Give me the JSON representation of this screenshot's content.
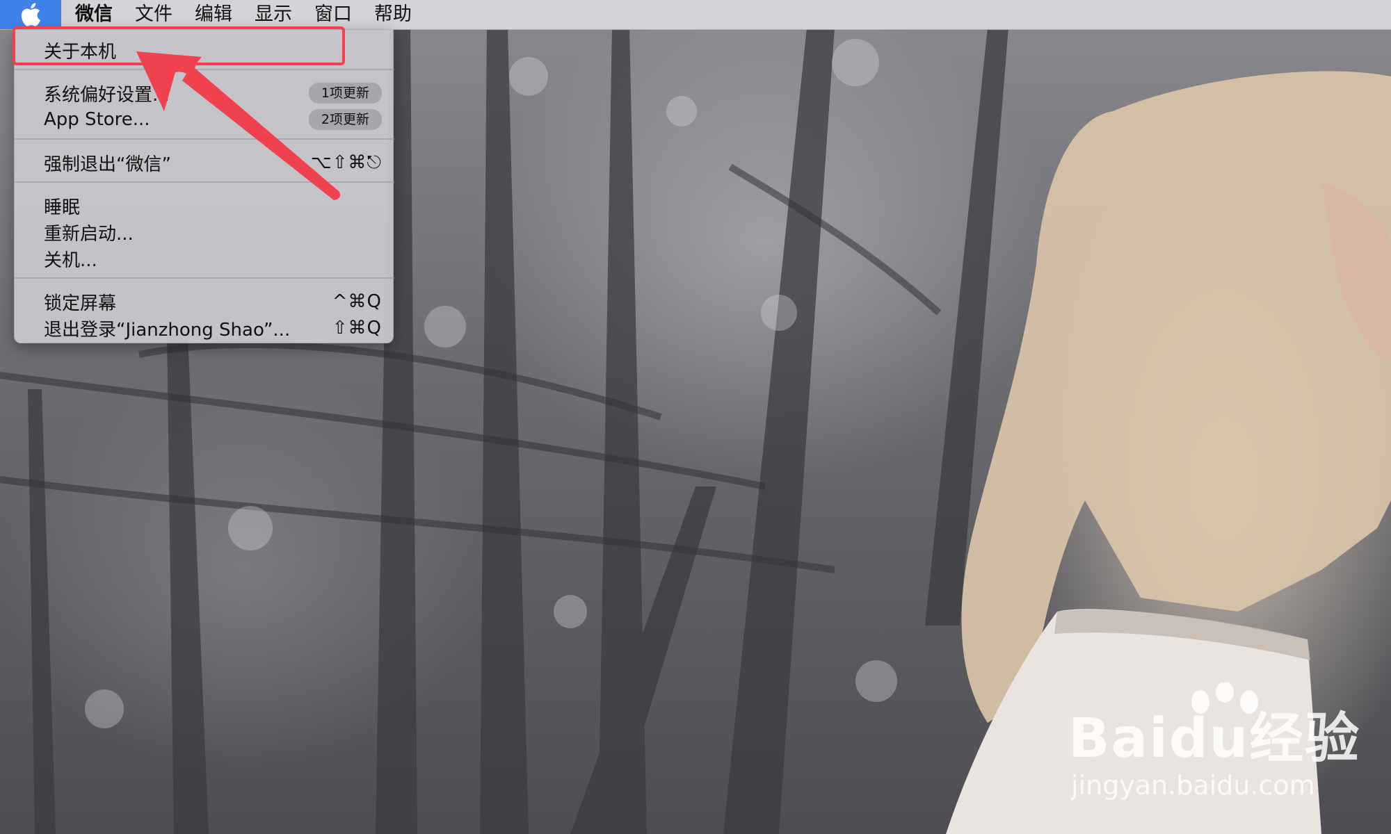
{
  "menubar": {
    "items": [
      "微信",
      "文件",
      "编辑",
      "显示",
      "窗口",
      "帮助"
    ]
  },
  "apple_menu": {
    "about": "关于本机",
    "system_prefs": "系统偏好设置...",
    "system_prefs_badge": "1项更新",
    "app_store": "App Store...",
    "app_store_badge": "2项更新",
    "force_quit": "强制退出“微信”",
    "force_quit_shortcut": "⌥⇧⌘⎋",
    "sleep": "睡眠",
    "restart": "重新启动...",
    "shutdown": "关机...",
    "lock_screen": "锁定屏幕",
    "lock_screen_shortcut": "^⌘Q",
    "logout": "退出登录“Jianzhong Shao”...",
    "logout_shortcut": "⇧⌘Q"
  },
  "watermark": {
    "brand": "Baidu经验",
    "url": "jingyan.baidu.com"
  },
  "colors": {
    "annotation": "#f0414f",
    "apple_slot": "#3f83e8"
  }
}
